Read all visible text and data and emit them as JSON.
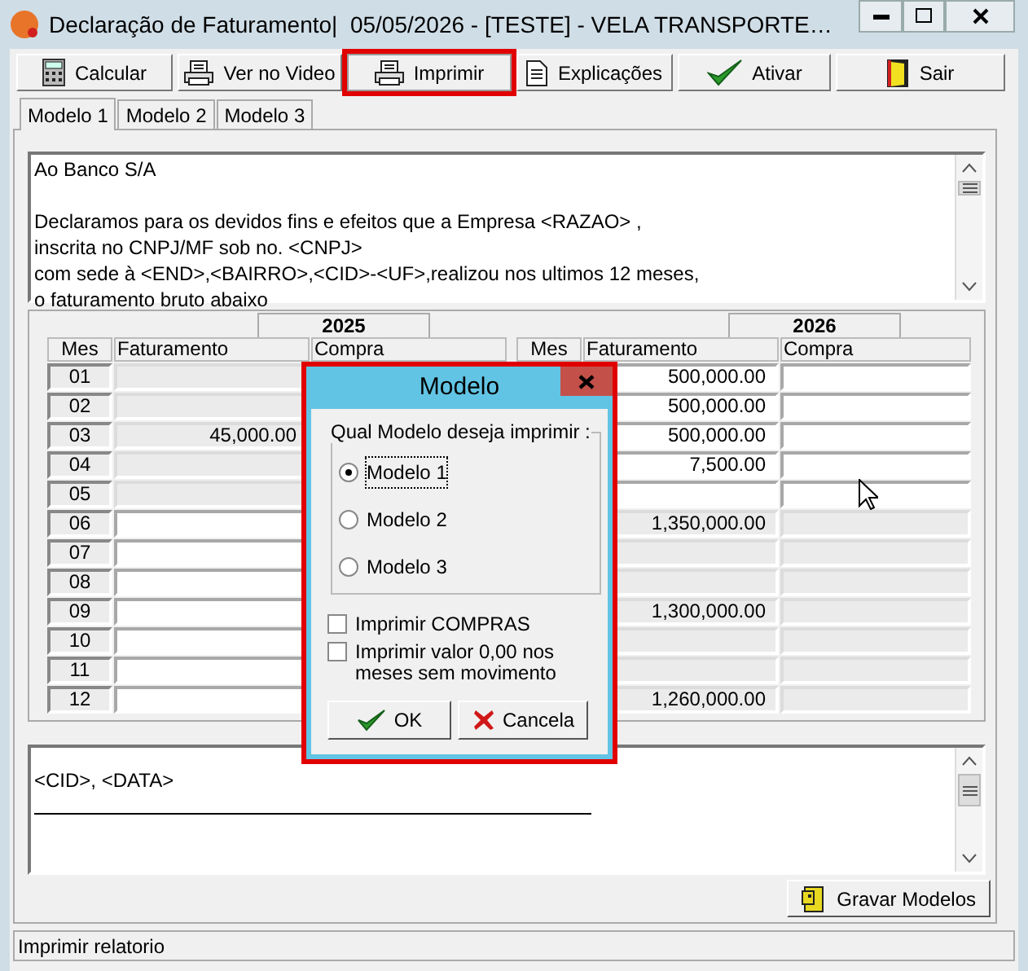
{
  "window": {
    "title": "Declaração de Faturamento|  05/05/2026 - [TESTE] - VELA TRANSPORTE…"
  },
  "toolbar": [
    {
      "label": "Calcular",
      "highlighted": false
    },
    {
      "label": "Ver no Video",
      "highlighted": false
    },
    {
      "label": "Imprimir",
      "highlighted": true
    },
    {
      "label": "Explicações",
      "highlighted": false
    },
    {
      "label": "Ativar",
      "highlighted": false
    },
    {
      "label": "Sair",
      "highlighted": false
    }
  ],
  "tabs": [
    {
      "label": "Modelo 1",
      "selected": true
    },
    {
      "label": "Modelo 2",
      "selected": false
    },
    {
      "label": "Modelo 3",
      "selected": false
    }
  ],
  "header_text": "Ao Banco S/A\n\nDeclaramos para os devidos fins e efeitos que a Empresa <RAZAO> ,\ninscrita no CNPJ/MF sob no. <CNPJ>\ncom sede à <END>,<BAIRRO>,<CID>-<UF>,realizou nos ultimos 12 meses,\no faturamento bruto abaixo",
  "years": [
    {
      "year": "2025",
      "columns": [
        "Mes",
        "Faturamento",
        "Compra"
      ],
      "rows": [
        {
          "month": "01",
          "disabled": true
        },
        {
          "month": "02",
          "disabled": true
        },
        {
          "month": "03",
          "faturamento": "45,000.00",
          "disabled": true
        },
        {
          "month": "04",
          "disabled": true
        },
        {
          "month": "05",
          "disabled": true
        },
        {
          "month": "06",
          "disabled": false
        },
        {
          "month": "07",
          "disabled": false
        },
        {
          "month": "08",
          "disabled": false
        },
        {
          "month": "09",
          "disabled": false
        },
        {
          "month": "10",
          "disabled": false
        },
        {
          "month": "11",
          "disabled": false
        },
        {
          "month": "12",
          "disabled": false
        }
      ]
    },
    {
      "year": "2026",
      "columns": [
        "Mes",
        "Faturamento",
        "Compra"
      ],
      "rows": [
        {
          "faturamento": "500,000.00",
          "disabled": false
        },
        {
          "faturamento": "500,000.00",
          "disabled": false
        },
        {
          "faturamento": "500,000.00",
          "disabled": false
        },
        {
          "faturamento": "7,500.00",
          "disabled": false
        },
        {
          "disabled": false
        },
        {
          "faturamento": "1,350,000.00",
          "disabled": true
        },
        {
          "disabled": true
        },
        {
          "disabled": true
        },
        {
          "faturamento": "1,300,000.00",
          "disabled": true
        },
        {
          "disabled": true
        },
        {
          "disabled": true
        },
        {
          "faturamento": "1,260,000.00",
          "disabled": true
        }
      ]
    }
  ],
  "footer_text": "<CID>, <DATA>",
  "save_button": {
    "label": "Gravar Modelos"
  },
  "status_bar": "Imprimir relatorio",
  "dialog": {
    "title": "Modelo",
    "group_label": "Qual Modelo deseja imprimir :",
    "options": [
      {
        "label": "Modelo 1",
        "selected": true
      },
      {
        "label": "Modelo 2",
        "selected": false
      },
      {
        "label": "Modelo 3",
        "selected": false
      }
    ],
    "checkboxes": [
      {
        "label": "Imprimir COMPRAS",
        "checked": false
      },
      {
        "label": "Imprimir valor 0,00 nos meses sem movimento",
        "checked": false
      }
    ],
    "buttons": [
      {
        "label": "OK",
        "kind": "ok"
      },
      {
        "label": "Cancela",
        "kind": "cancel"
      }
    ]
  }
}
